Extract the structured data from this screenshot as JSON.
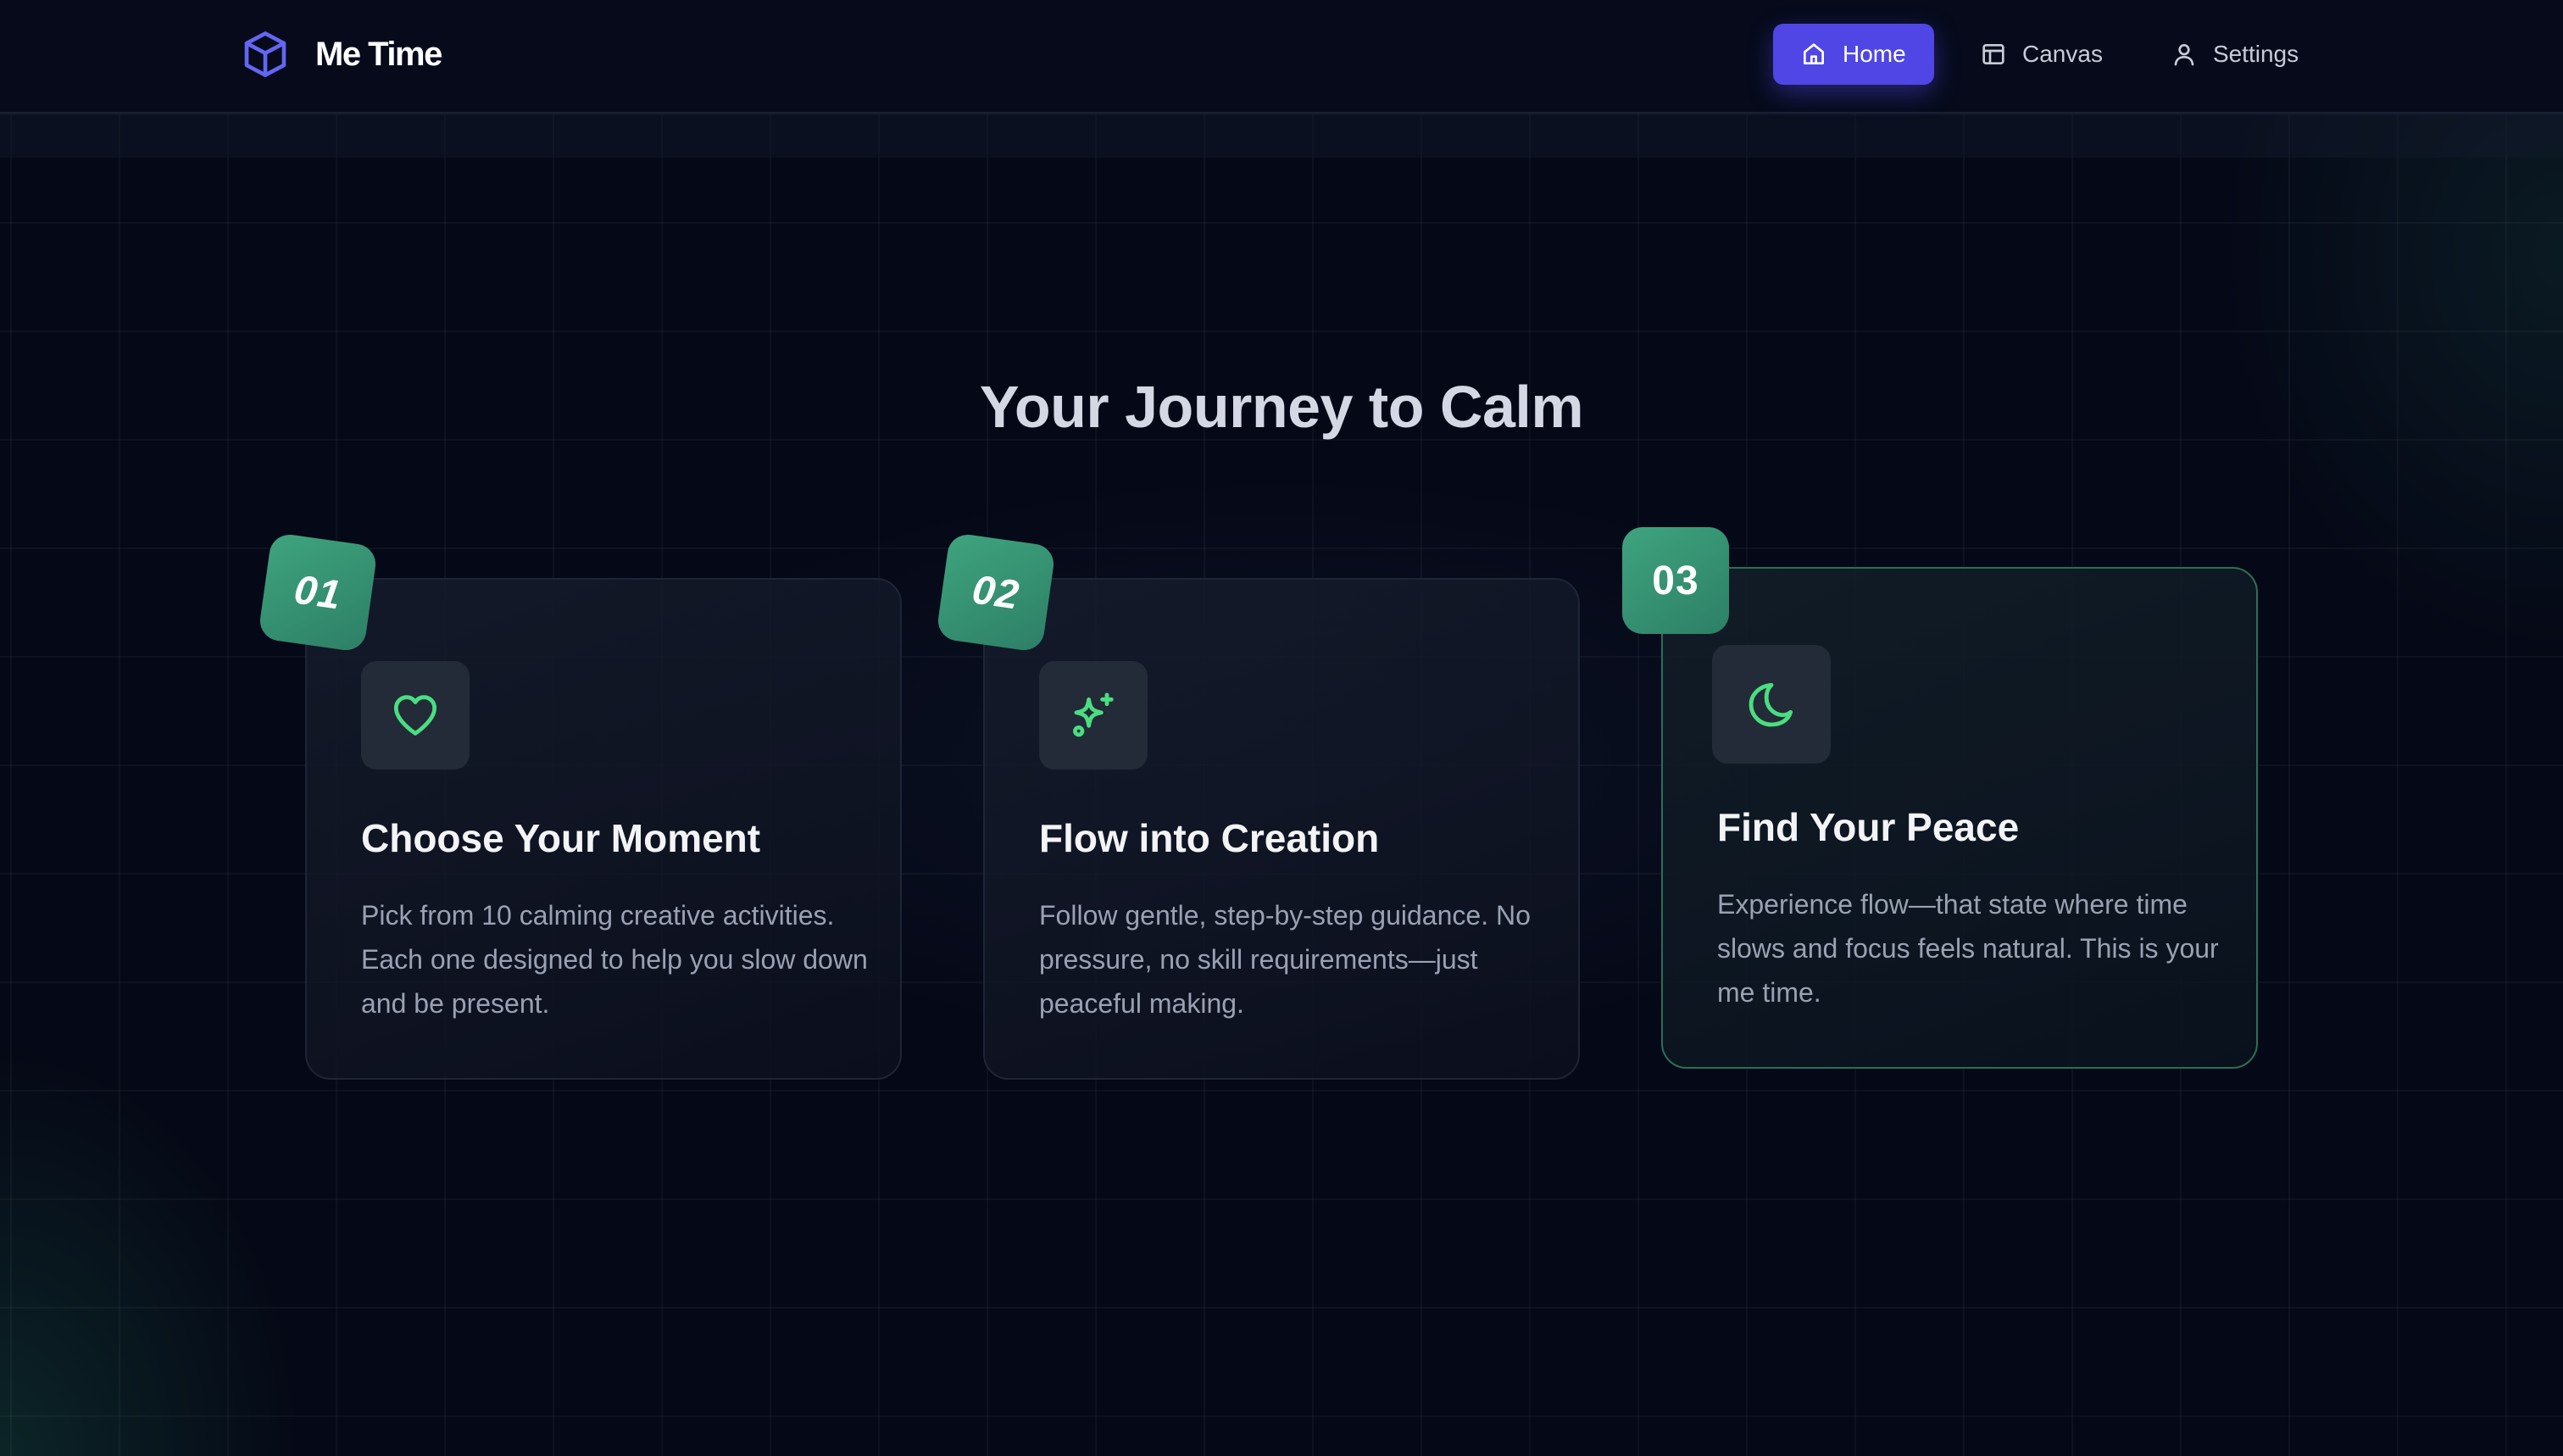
{
  "brand": {
    "name": "Me Time",
    "icon": "cube-icon",
    "accent": "#6366f1"
  },
  "nav": {
    "items": [
      {
        "label": "Home",
        "icon": "home-icon",
        "active": true
      },
      {
        "label": "Canvas",
        "icon": "layout-icon",
        "active": false
      },
      {
        "label": "Settings",
        "icon": "user-icon",
        "active": false
      }
    ],
    "active_color": "#4f46e5"
  },
  "section": {
    "title": "Your Journey to Calm",
    "steps": [
      {
        "number": "01",
        "icon": "heart-icon",
        "title": "Choose Your Moment",
        "text": "Pick from 10 calming creative activities. Each one designed to help you slow down and be present."
      },
      {
        "number": "02",
        "icon": "sparkles-icon",
        "title": "Flow into Creation",
        "text": "Follow gentle, step-by-step guidance. No pressure, no skill requirements—just peaceful making."
      },
      {
        "number": "03",
        "icon": "moon-icon",
        "title": "Find Your Peace",
        "text": "Experience flow—that state where time slows and focus feels natural. This is your me time."
      }
    ]
  },
  "colors": {
    "badge": "#3a9a78",
    "icon_stroke": "#4ade80",
    "background": "#050816"
  }
}
